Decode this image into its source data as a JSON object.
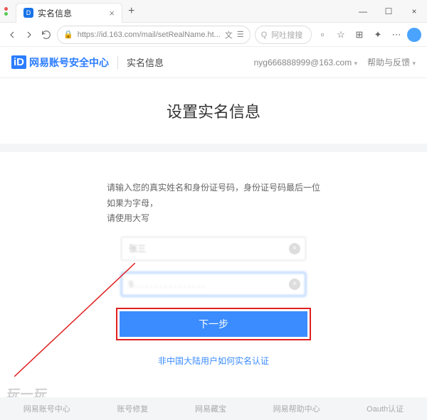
{
  "browser": {
    "tab_title": "实名信息",
    "url": "https://id.163.com/mail/setRealName.ht...",
    "search_placeholder": "阿吐搜搜"
  },
  "header": {
    "logo_text": "网易账号安全中心",
    "breadcrumb": "实名信息",
    "user_email": "nyg666888999@163.com",
    "help_label": "帮助与反馈"
  },
  "page": {
    "title": "设置实名信息",
    "instruction_line1": "请输入您的真实姓名和身份证号码，身份证号码最后一位如果为字母，",
    "instruction_line2": "请使用大写",
    "name_value": "张三",
    "id_value": "5 . . . . . . . . . . . . . . .",
    "submit_label": "下一步",
    "alt_link": "非中国大陆用户如何实名认证"
  },
  "footer": {
    "links": [
      "网易账号中心",
      "账号修复",
      "网易藏宝",
      "网易帮助中心",
      "Oauth认证"
    ]
  },
  "watermark": "玩一玩"
}
